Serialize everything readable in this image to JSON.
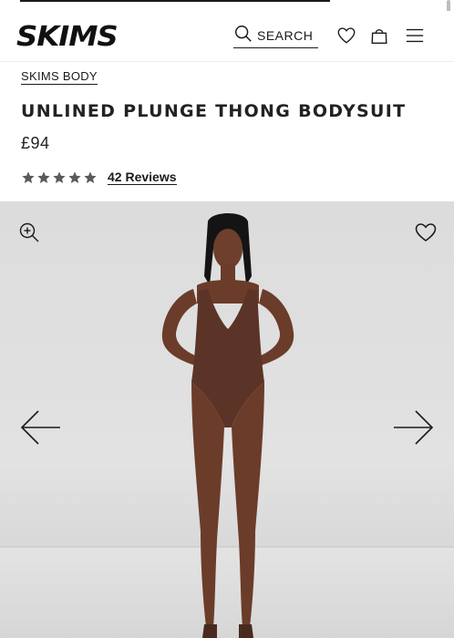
{
  "header": {
    "logo": "SKIMS",
    "search_label": "SEARCH"
  },
  "product": {
    "breadcrumb": "SKIMS BODY",
    "title": "UNLINED PLUNGE THONG BODYSUIT",
    "price": "£94",
    "rating": 5,
    "reviews_label": "42 Reviews"
  },
  "gallery": {
    "image_alt": "Model wearing unlined plunge thong bodysuit in cocoa"
  },
  "colors": {
    "text": "#1a1a1a",
    "star": "#5a5a5a",
    "bodysuit": "#5b3427",
    "background_gray": "#dedede"
  }
}
